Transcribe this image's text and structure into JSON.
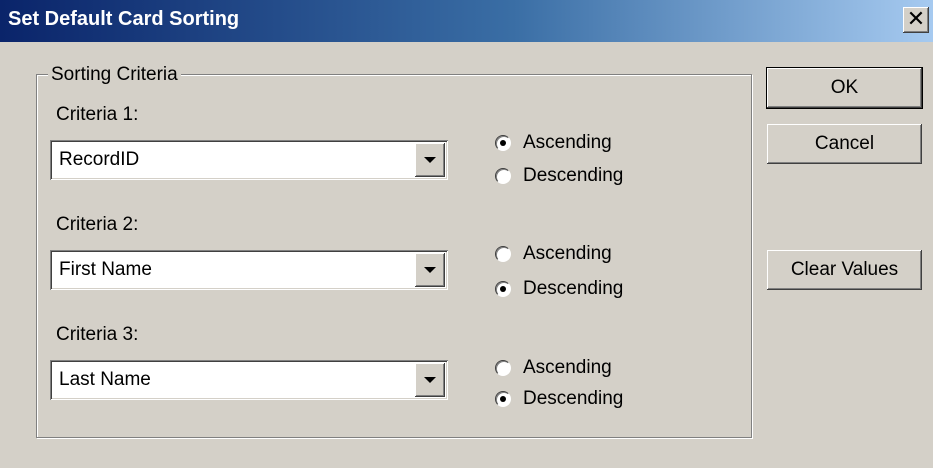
{
  "window": {
    "title": "Set Default Card Sorting",
    "close_glyph": "✕",
    "colors": {
      "title_start": "#0a246a",
      "title_end": "#a6caf0",
      "face": "#d4d0c8"
    }
  },
  "group": {
    "legend": "Sorting Criteria"
  },
  "criteria": [
    {
      "label": "Criteria 1:",
      "value": "RecordID",
      "ascending": "Ascending",
      "descending": "Descending",
      "selected": "ascending"
    },
    {
      "label": "Criteria 2:",
      "value": "First Name",
      "ascending": "Ascending",
      "descending": "Descending",
      "selected": "descending"
    },
    {
      "label": "Criteria 3:",
      "value": "Last Name",
      "ascending": "Ascending",
      "descending": "Descending",
      "selected": "descending"
    }
  ],
  "buttons": {
    "ok": "OK",
    "cancel": "Cancel",
    "clear": "Clear Values"
  },
  "icons": {
    "close": "close-icon",
    "dropdown": "chevron-down-icon",
    "radio": "radio-icon"
  }
}
